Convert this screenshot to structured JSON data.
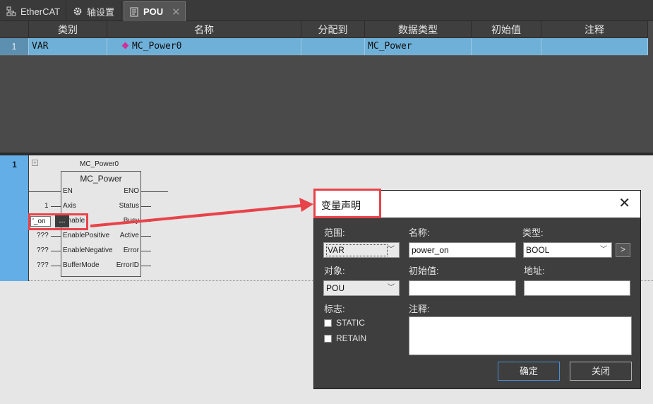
{
  "tabs": [
    {
      "label": "EtherCAT",
      "icon": "network-icon"
    },
    {
      "label": "轴设置",
      "icon": "gear-icon"
    },
    {
      "label": "POU",
      "icon": "document-icon",
      "close": "✕"
    }
  ],
  "var_table": {
    "headers": [
      "类别",
      "名称",
      "分配到",
      "数据类型",
      "初始值",
      "注释"
    ],
    "rows": [
      {
        "num": "1",
        "category": "VAR",
        "name": "MC_Power0",
        "assign": "",
        "type": "MC_Power",
        "init": "",
        "comment": ""
      }
    ]
  },
  "ladder": {
    "rung_number": "1",
    "fb_instance": "MC_Power0",
    "fb_type": "MC_Power",
    "left_pins": [
      "EN",
      "Axis",
      "Enable",
      "EnablePositive",
      "EnableNegative",
      "BufferMode"
    ],
    "right_pins": [
      "ENO",
      "Status",
      "Busy",
      "Active",
      "Error",
      "ErrorID"
    ],
    "input_values": [
      "",
      "1",
      "",
      "???",
      "???",
      "???"
    ],
    "enable_input_text": "'_on",
    "ellipsis": "..."
  },
  "dialog": {
    "title": "变量声明",
    "close": "✕",
    "scope_label": "范围:",
    "scope_value": "VAR",
    "name_label": "名称:",
    "name_value": "power_on",
    "type_label": "类型:",
    "type_value": "BOOL",
    "type_browse": ">",
    "object_label": "对象:",
    "object_value": "POU",
    "init_label": "初始值:",
    "init_value": "",
    "address_label": "地址:",
    "address_value": "",
    "flags_label": "标志:",
    "flag_static": "STATIC",
    "flag_retain": "RETAIN",
    "comment_label": "注释:",
    "comment_value": "",
    "ok_label": "确定",
    "cancel_label": "关闭"
  },
  "colors": {
    "selected_row": "#6fb0d8",
    "rung_bar": "#63aee6",
    "highlight": "#e8434a"
  }
}
